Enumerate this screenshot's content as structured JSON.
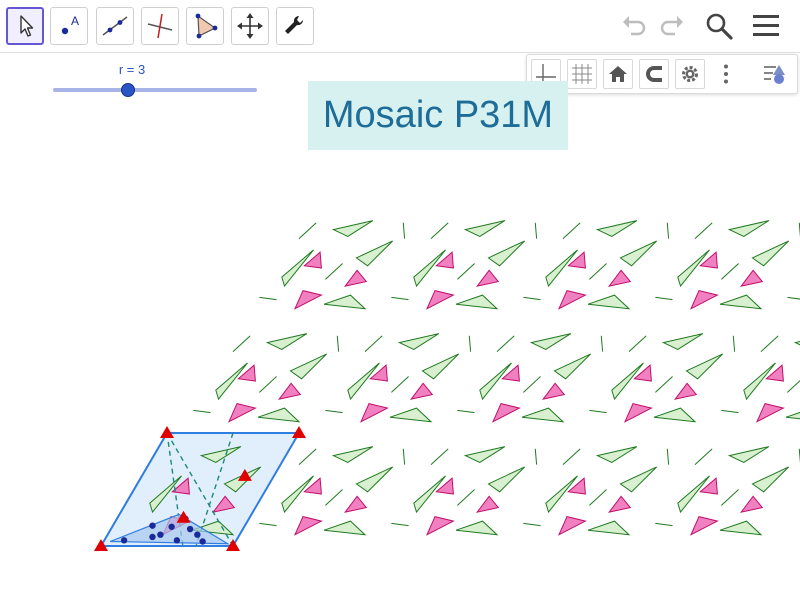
{
  "toolbar": {
    "tools": [
      {
        "name": "move-tool",
        "icon": "arrow-cursor-icon",
        "active": true
      },
      {
        "name": "point-tool",
        "icon": "point-icon",
        "label": "A"
      },
      {
        "name": "line-tool",
        "icon": "line-through-points-icon"
      },
      {
        "name": "perpendicular-line-tool",
        "icon": "perpendicular-line-icon"
      },
      {
        "name": "polygon-tool",
        "icon": "polygon-icon"
      },
      {
        "name": "move-graphics-view-tool",
        "icon": "move-arrows-icon"
      },
      {
        "name": "tools-tool",
        "icon": "wrench-icon"
      }
    ],
    "right": [
      "undo-icon",
      "redo-icon",
      "search-icon",
      "menu-icon"
    ]
  },
  "style_bar": [
    "axes-icon",
    "grid-icon",
    "home-icon",
    "magnet-icon",
    "settings-icon",
    "more-icon",
    "toggle-style-bar-icon"
  ],
  "slider": {
    "label": "r = 3",
    "value": 3,
    "fraction": 0.37
  },
  "title": "Mosaic P31M",
  "colors": {
    "green_fill": "#d8f0d0",
    "green_stroke": "#1f7a1f",
    "pink_fill": "#f080c0",
    "pink_stroke": "#c0106a",
    "cell_fill": "#cde2f8",
    "cell_stroke": "#2f7de0",
    "vertex_marker": "#e00000",
    "point": "#1a2a9a"
  }
}
